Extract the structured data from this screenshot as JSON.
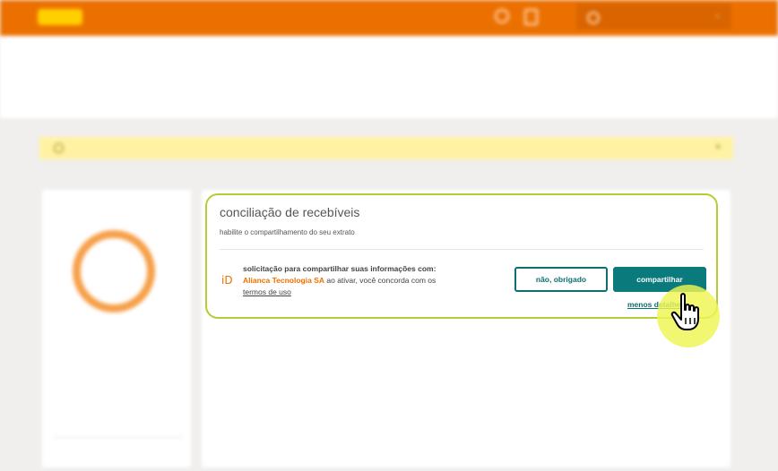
{
  "consent_card": {
    "title": "conciliação de recebíveis",
    "subtitle": "habilite o compartilhamento do seu extrato",
    "icon_glyph": "iD",
    "request_text": "solicitação para compartilhar suas informações com:",
    "company": "Alianca Tecnologia SA",
    "agree_text": "ao ativar, você concorda com os",
    "terms_link": "termos de uso",
    "decline_button": "não, obrigado",
    "share_button": "compartilhar",
    "more_details_link": "menos detalhes"
  },
  "colors": {
    "brand_orange": "#ec7000",
    "teal": "#0b7a7d",
    "focus_border": "#b4cd37",
    "cursor_highlight": "#eef550"
  },
  "icons": [
    "logo-icon",
    "search-icon",
    "bag-icon",
    "user-icon",
    "chevron-down-icon",
    "info-icon",
    "close-icon",
    "id-icon",
    "hand-pointer-icon"
  ]
}
